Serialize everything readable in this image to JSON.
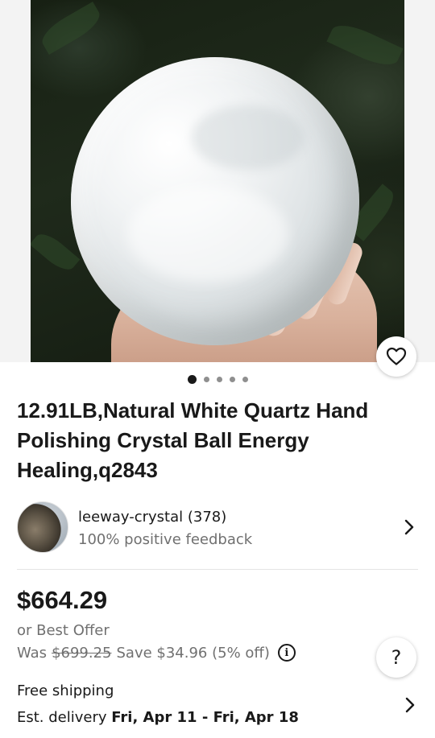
{
  "gallery": {
    "image_alt": "White quartz crystal ball held in hand",
    "favorite_icon": "heart-outline-icon",
    "page_count": 5,
    "active_page": 1
  },
  "listing": {
    "title": "12.91LB,Natural White Quartz Hand Polishing Crystal Ball Energy Healing,q2843"
  },
  "seller": {
    "name_line": "leeway-crystal (378)",
    "feedback": "100% positive feedback"
  },
  "pricing": {
    "price": "$664.29",
    "best_offer": "or Best Offer",
    "was_label": "Was",
    "was_price": "$699.25",
    "save_text": "Save $34.96 (5% off)"
  },
  "help_label": "?",
  "shipping": {
    "label": "Free shipping",
    "est_label": "Est. delivery",
    "est_dates": "Fri, Apr 11 - Fri, Apr 18"
  },
  "colors": {
    "text": "#191919",
    "secondary_text": "#707070",
    "divider": "#e5e5e5"
  }
}
